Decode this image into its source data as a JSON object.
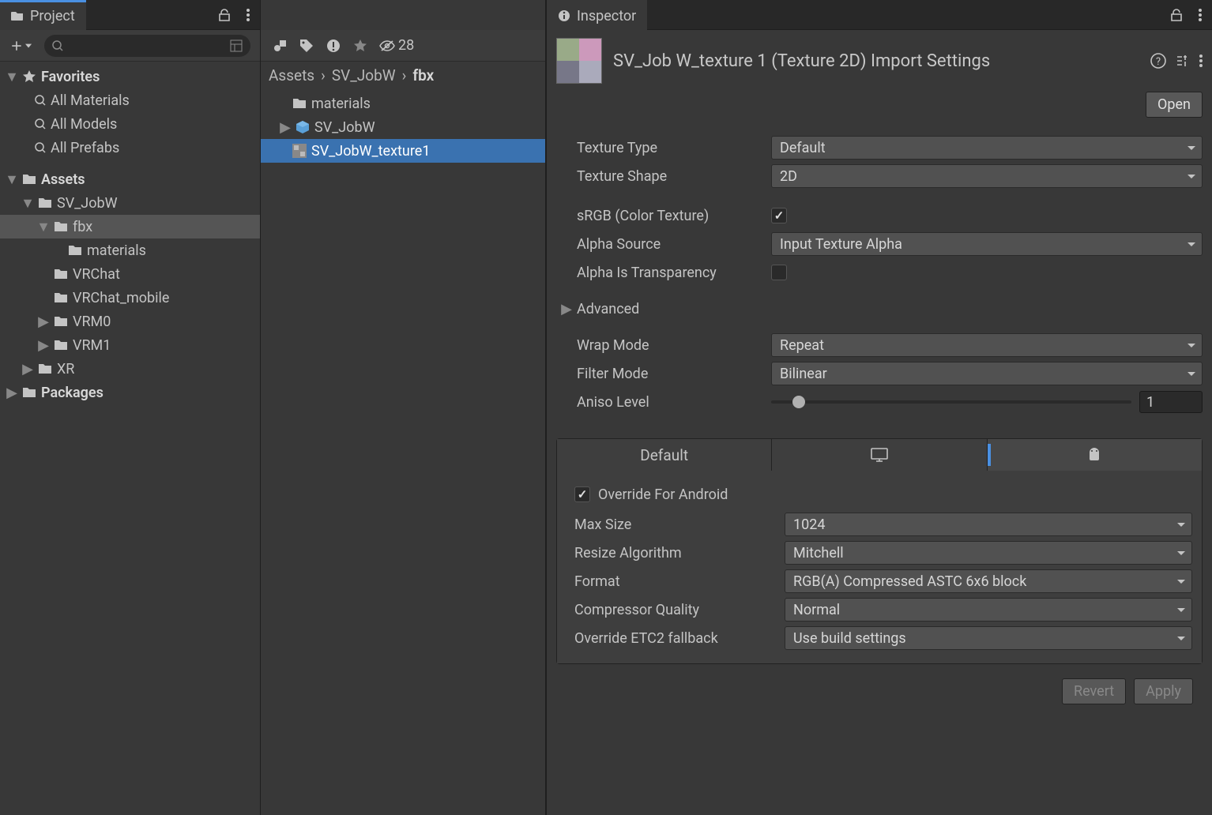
{
  "project": {
    "tab": "Project",
    "search_placeholder": "",
    "hidden_count": "28"
  },
  "tree": {
    "favorites": "Favorites",
    "fav_items": [
      "All Materials",
      "All Models",
      "All Prefabs"
    ],
    "assets": "Assets",
    "sv_jobw": "SV_JobW",
    "fbx": "fbx",
    "materials": "materials",
    "vrchat": "VRChat",
    "vrchat_mobile": "VRChat_mobile",
    "vrm0": "VRM0",
    "vrm1": "VRM1",
    "xr": "XR",
    "packages": "Packages"
  },
  "breadcrumb": {
    "a": "Assets",
    "b": "SV_JobW",
    "c": "fbx"
  },
  "mid_list": {
    "materials": "materials",
    "sv_jobw": "SV_JobW",
    "texture": "SV_JobW_texture1"
  },
  "inspector": {
    "tab": "Inspector",
    "title": "SV_Job W_texture 1 (Texture 2D) Import Settings",
    "open": "Open",
    "labels": {
      "texture_type": "Texture Type",
      "texture_shape": "Texture Shape",
      "srgb": "sRGB (Color Texture)",
      "alpha_source": "Alpha Source",
      "alpha_transparency": "Alpha Is Transparency",
      "advanced": "Advanced",
      "wrap_mode": "Wrap Mode",
      "filter_mode": "Filter Mode",
      "aniso_level": "Aniso Level"
    },
    "values": {
      "texture_type": "Default",
      "texture_shape": "2D",
      "alpha_source": "Input Texture Alpha",
      "wrap_mode": "Repeat",
      "filter_mode": "Bilinear",
      "aniso_level": "1"
    },
    "srgb_checked": true,
    "alpha_transparency_checked": false,
    "platform": {
      "default_tab": "Default",
      "override_label": "Override For Android",
      "override_checked": true,
      "labels": {
        "max_size": "Max Size",
        "resize_algorithm": "Resize Algorithm",
        "format": "Format",
        "compressor_quality": "Compressor Quality",
        "override_etc2": "Override ETC2 fallback"
      },
      "values": {
        "max_size": "1024",
        "resize_algorithm": "Mitchell",
        "format": "RGB(A) Compressed ASTC 6x6 block",
        "compressor_quality": "Normal",
        "override_etc2": "Use build settings"
      }
    },
    "revert": "Revert",
    "apply": "Apply"
  }
}
